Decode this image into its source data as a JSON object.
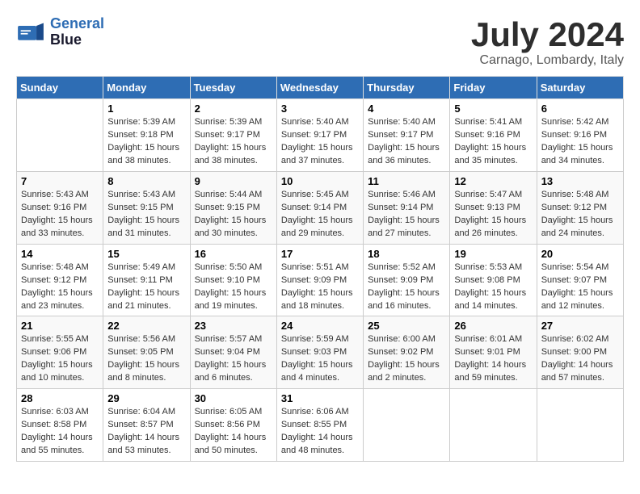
{
  "header": {
    "logo_line1": "General",
    "logo_line2": "Blue",
    "month_title": "July 2024",
    "location": "Carnago, Lombardy, Italy"
  },
  "days_of_week": [
    "Sunday",
    "Monday",
    "Tuesday",
    "Wednesday",
    "Thursday",
    "Friday",
    "Saturday"
  ],
  "weeks": [
    [
      {
        "day": "",
        "info": ""
      },
      {
        "day": "1",
        "info": "Sunrise: 5:39 AM\nSunset: 9:18 PM\nDaylight: 15 hours\nand 38 minutes."
      },
      {
        "day": "2",
        "info": "Sunrise: 5:39 AM\nSunset: 9:17 PM\nDaylight: 15 hours\nand 38 minutes."
      },
      {
        "day": "3",
        "info": "Sunrise: 5:40 AM\nSunset: 9:17 PM\nDaylight: 15 hours\nand 37 minutes."
      },
      {
        "day": "4",
        "info": "Sunrise: 5:40 AM\nSunset: 9:17 PM\nDaylight: 15 hours\nand 36 minutes."
      },
      {
        "day": "5",
        "info": "Sunrise: 5:41 AM\nSunset: 9:16 PM\nDaylight: 15 hours\nand 35 minutes."
      },
      {
        "day": "6",
        "info": "Sunrise: 5:42 AM\nSunset: 9:16 PM\nDaylight: 15 hours\nand 34 minutes."
      }
    ],
    [
      {
        "day": "7",
        "info": "Sunrise: 5:43 AM\nSunset: 9:16 PM\nDaylight: 15 hours\nand 33 minutes."
      },
      {
        "day": "8",
        "info": "Sunrise: 5:43 AM\nSunset: 9:15 PM\nDaylight: 15 hours\nand 31 minutes."
      },
      {
        "day": "9",
        "info": "Sunrise: 5:44 AM\nSunset: 9:15 PM\nDaylight: 15 hours\nand 30 minutes."
      },
      {
        "day": "10",
        "info": "Sunrise: 5:45 AM\nSunset: 9:14 PM\nDaylight: 15 hours\nand 29 minutes."
      },
      {
        "day": "11",
        "info": "Sunrise: 5:46 AM\nSunset: 9:14 PM\nDaylight: 15 hours\nand 27 minutes."
      },
      {
        "day": "12",
        "info": "Sunrise: 5:47 AM\nSunset: 9:13 PM\nDaylight: 15 hours\nand 26 minutes."
      },
      {
        "day": "13",
        "info": "Sunrise: 5:48 AM\nSunset: 9:12 PM\nDaylight: 15 hours\nand 24 minutes."
      }
    ],
    [
      {
        "day": "14",
        "info": "Sunrise: 5:48 AM\nSunset: 9:12 PM\nDaylight: 15 hours\nand 23 minutes."
      },
      {
        "day": "15",
        "info": "Sunrise: 5:49 AM\nSunset: 9:11 PM\nDaylight: 15 hours\nand 21 minutes."
      },
      {
        "day": "16",
        "info": "Sunrise: 5:50 AM\nSunset: 9:10 PM\nDaylight: 15 hours\nand 19 minutes."
      },
      {
        "day": "17",
        "info": "Sunrise: 5:51 AM\nSunset: 9:09 PM\nDaylight: 15 hours\nand 18 minutes."
      },
      {
        "day": "18",
        "info": "Sunrise: 5:52 AM\nSunset: 9:09 PM\nDaylight: 15 hours\nand 16 minutes."
      },
      {
        "day": "19",
        "info": "Sunrise: 5:53 AM\nSunset: 9:08 PM\nDaylight: 15 hours\nand 14 minutes."
      },
      {
        "day": "20",
        "info": "Sunrise: 5:54 AM\nSunset: 9:07 PM\nDaylight: 15 hours\nand 12 minutes."
      }
    ],
    [
      {
        "day": "21",
        "info": "Sunrise: 5:55 AM\nSunset: 9:06 PM\nDaylight: 15 hours\nand 10 minutes."
      },
      {
        "day": "22",
        "info": "Sunrise: 5:56 AM\nSunset: 9:05 PM\nDaylight: 15 hours\nand 8 minutes."
      },
      {
        "day": "23",
        "info": "Sunrise: 5:57 AM\nSunset: 9:04 PM\nDaylight: 15 hours\nand 6 minutes."
      },
      {
        "day": "24",
        "info": "Sunrise: 5:59 AM\nSunset: 9:03 PM\nDaylight: 15 hours\nand 4 minutes."
      },
      {
        "day": "25",
        "info": "Sunrise: 6:00 AM\nSunset: 9:02 PM\nDaylight: 15 hours\nand 2 minutes."
      },
      {
        "day": "26",
        "info": "Sunrise: 6:01 AM\nSunset: 9:01 PM\nDaylight: 14 hours\nand 59 minutes."
      },
      {
        "day": "27",
        "info": "Sunrise: 6:02 AM\nSunset: 9:00 PM\nDaylight: 14 hours\nand 57 minutes."
      }
    ],
    [
      {
        "day": "28",
        "info": "Sunrise: 6:03 AM\nSunset: 8:58 PM\nDaylight: 14 hours\nand 55 minutes."
      },
      {
        "day": "29",
        "info": "Sunrise: 6:04 AM\nSunset: 8:57 PM\nDaylight: 14 hours\nand 53 minutes."
      },
      {
        "day": "30",
        "info": "Sunrise: 6:05 AM\nSunset: 8:56 PM\nDaylight: 14 hours\nand 50 minutes."
      },
      {
        "day": "31",
        "info": "Sunrise: 6:06 AM\nSunset: 8:55 PM\nDaylight: 14 hours\nand 48 minutes."
      },
      {
        "day": "",
        "info": ""
      },
      {
        "day": "",
        "info": ""
      },
      {
        "day": "",
        "info": ""
      }
    ]
  ]
}
